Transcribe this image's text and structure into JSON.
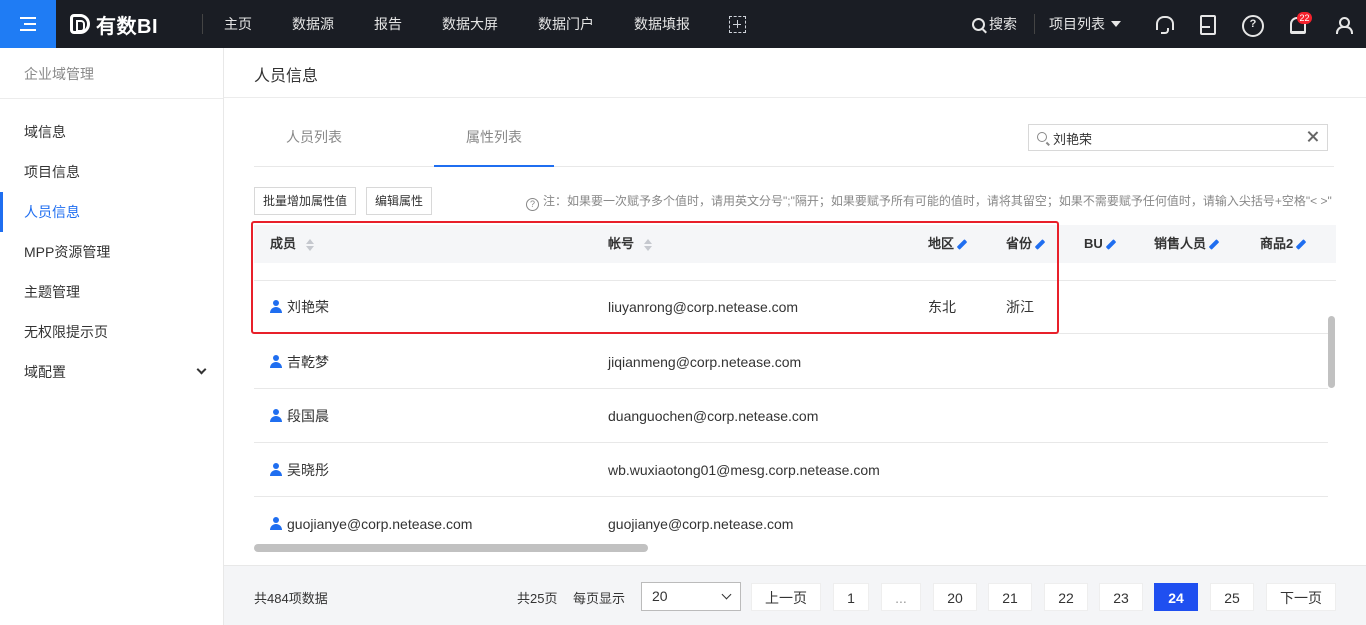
{
  "app": {
    "logo_text": "有数BI",
    "nav": [
      "主页",
      "数据源",
      "报告",
      "数据大屏",
      "数据门户",
      "数据填报"
    ],
    "search_label": "搜索",
    "project_list_label": "项目列表",
    "notification_count": "22",
    "accent_color": "#1f6ef0"
  },
  "sidebar": {
    "title": "企业域管理",
    "items": [
      {
        "label": "域信息"
      },
      {
        "label": "项目信息"
      },
      {
        "label": "人员信息",
        "active": true
      },
      {
        "label": "MPP资源管理"
      },
      {
        "label": "主题管理"
      },
      {
        "label": "无权限提示页"
      },
      {
        "label": "域配置",
        "has_children": true
      }
    ]
  },
  "main": {
    "page_title": "人员信息",
    "tabs": [
      {
        "label": "人员列表"
      },
      {
        "label": "属性列表",
        "active": true
      }
    ],
    "search": {
      "value": "刘艳荣"
    },
    "buttons": {
      "batch_add": "批量增加属性值",
      "edit_attr": "编辑属性"
    },
    "note": "注：如果要一次赋予多个值时，请用英文分号\";\"隔开；如果要赋予所有可能的值时，请将其留空；如果不需要赋予任何值时，请输入尖括号+空格\"< >\"",
    "table": {
      "columns": [
        "成员",
        "帐号",
        "地区",
        "省份",
        "BU",
        "销售人员",
        "商品2"
      ],
      "rows": [
        {
          "member": "刘艳荣",
          "account": "liuyanrong@corp.netease.com",
          "region": "东北",
          "province": "浙江"
        },
        {
          "member": "吉乾梦",
          "account": "jiqianmeng@corp.netease.com",
          "region": "",
          "province": ""
        },
        {
          "member": "段国晨",
          "account": "duanguochen@corp.netease.com",
          "region": "",
          "province": ""
        },
        {
          "member": "吴晓彤",
          "account": "wb.wuxiaotong01@mesg.corp.netease.com",
          "region": "",
          "province": ""
        },
        {
          "member": "guojianye@corp.netease.com",
          "account": "guojianye@corp.netease.com",
          "region": "",
          "province": ""
        }
      ]
    }
  },
  "pagination": {
    "total": "共484项数据",
    "pages_total": "共25页",
    "per_page_label": "每页显示",
    "per_page_value": "20",
    "prev": "上一页",
    "next": "下一页",
    "pages": [
      "1",
      "...",
      "20",
      "21",
      "22",
      "23",
      "24",
      "25"
    ],
    "current": "24"
  }
}
